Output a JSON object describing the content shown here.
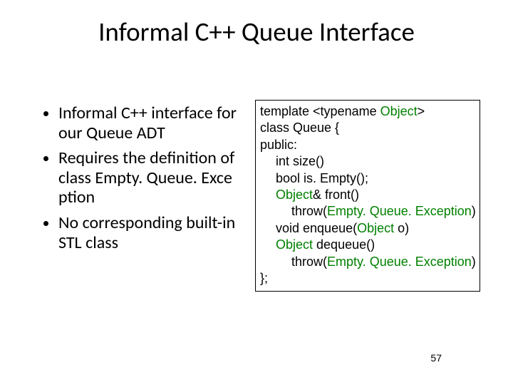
{
  "title": "Informal C++ Queue Interface",
  "bullets": {
    "b1": "Informal C++ interface for our Queue ADT",
    "b2_lead": "Requires the definition of class ",
    "b2_class": "Empty. Queue. Exce ption",
    "b3": "No corresponding built-in STL class"
  },
  "code": {
    "l1a": "template <typename ",
    "l1b": "Object",
    "l1c": ">",
    "l2": "class Queue {",
    "l3": "public:",
    "l4": "int size()",
    "l5": "bool is. Empty();",
    "l6a": "Object",
    "l6b": "& front()",
    "l7a": "throw(",
    "l7b": "Empty. Queue. Exception",
    "l7c": ")",
    "l8a": "void enqueue(",
    "l8b": "Object",
    "l8c": " o)",
    "l9a": "Object",
    "l9b": " dequeue()",
    "l10a": "throw(",
    "l10b": "Empty. Queue. Exception",
    "l10c": ")",
    "l11": "};"
  },
  "page": "57"
}
